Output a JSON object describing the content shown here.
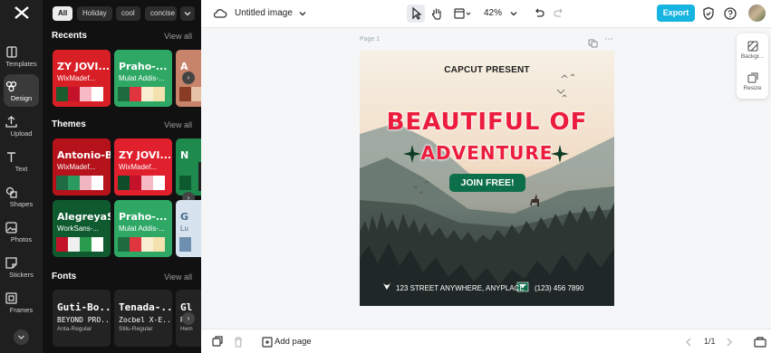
{
  "rail": {
    "items": [
      {
        "label": "Templates",
        "icon": "templates-icon"
      },
      {
        "label": "Design",
        "icon": "design-icon"
      },
      {
        "label": "Upload",
        "icon": "upload-icon"
      },
      {
        "label": "Text",
        "icon": "text-icon"
      },
      {
        "label": "Shapes",
        "icon": "shapes-icon"
      },
      {
        "label": "Photos",
        "icon": "photos-icon"
      },
      {
        "label": "Stickers",
        "icon": "stickers-icon"
      },
      {
        "label": "Frames",
        "icon": "frames-icon"
      }
    ]
  },
  "panel": {
    "tags": [
      "All",
      "Holiday",
      "cool",
      "concise"
    ],
    "recents": {
      "title": "Recents",
      "view_all": "View all"
    },
    "themes": {
      "title": "Themes",
      "view_all": "View all"
    },
    "fonts": {
      "title": "Fonts",
      "view_all": "View all"
    },
    "recent_cards": [
      {
        "title": "ZY JOVI...",
        "subtitle": "WixMadef...",
        "bg": "#d81f26",
        "colors": [
          "#1a5c2e",
          "#c4122a",
          "#f7b9c4",
          "#ffffff"
        ]
      },
      {
        "title": "Praho-...",
        "subtitle": "Mulat Addis-...",
        "bg": "#2fa866",
        "colors": [
          "#1d6b3f",
          "#e0353f",
          "#f7efcf",
          "#f4e1b0"
        ]
      },
      {
        "title": "A",
        "subtitle": "",
        "bg": "#c8846a",
        "colors": [
          "#8a3b24",
          "#e5c2a8"
        ]
      }
    ],
    "theme_cards": [
      {
        "title": "Antonio-Bold",
        "subtitle": "WixMadef...",
        "bg": "#b5121b",
        "colors": [
          "#1f6b44",
          "#2a9a5e",
          "#f1b4c1",
          "#ffffff"
        ]
      },
      {
        "title": "ZY JOVI...",
        "subtitle": "WixMadef...",
        "bg": "#e0202d",
        "colors": [
          "#0f4d2a",
          "#c4122a",
          "#f7b9c4",
          "#ffffff"
        ]
      },
      {
        "title": "N",
        "subtitle": "",
        "bg": "#1f8a4e",
        "colors": [
          "#0e5a30",
          "#1f8a4e"
        ]
      },
      {
        "title": "AlegreyaS...",
        "subtitle": "WorkSans-...",
        "bg": "#0f5a2f",
        "colors": [
          "#c4122a",
          "#f0f0f0",
          "#2a9a4e",
          "#ffffff"
        ]
      },
      {
        "title": "Praho-...",
        "subtitle": "Mulat Addis-...",
        "bg": "#2fa866",
        "colors": [
          "#1d6b3f",
          "#e0353f",
          "#f7efcf",
          "#f4e1b0"
        ]
      },
      {
        "title": "G",
        "subtitle": "Lu",
        "bg": "#d7e3ee",
        "colors": [
          "#6d8fb0",
          "#d7e3ee"
        ]
      }
    ],
    "font_cards": [
      {
        "line1": "Guti-Bo...",
        "line2": "BEYOND PRO...",
        "line3": "Anta-Regular"
      },
      {
        "line1": "Tenada-...",
        "line2": "Zocbel X-E...",
        "line3": "Stilu-Regular"
      },
      {
        "line1": "Gl",
        "line2": "R",
        "line3": "Hem"
      }
    ]
  },
  "topbar": {
    "title": "Untitled image",
    "zoom": "42%",
    "export_label": "Export"
  },
  "canvas": {
    "page_label": "Page 1",
    "poster": {
      "kicker": "CAPCUT PRESENT",
      "headline1": "BEAUTIFUL OF",
      "headline2": "ADVENTURE",
      "cta": "JOIN FREE!",
      "address": "123  STREET ANYWHERE, ANYPLACE",
      "phone": "(123)  456  7890",
      "colors": {
        "headline": "#ec1c3e",
        "cta_bg": "#0d6e4a",
        "dark_green": "#0b3d24"
      }
    }
  },
  "side_panel": {
    "items": [
      {
        "label": "Backgr...",
        "icon": "background-icon"
      },
      {
        "label": "Resize",
        "icon": "resize-icon"
      }
    ]
  },
  "bottombar": {
    "add_page": "Add page",
    "pagination": "1/1"
  }
}
